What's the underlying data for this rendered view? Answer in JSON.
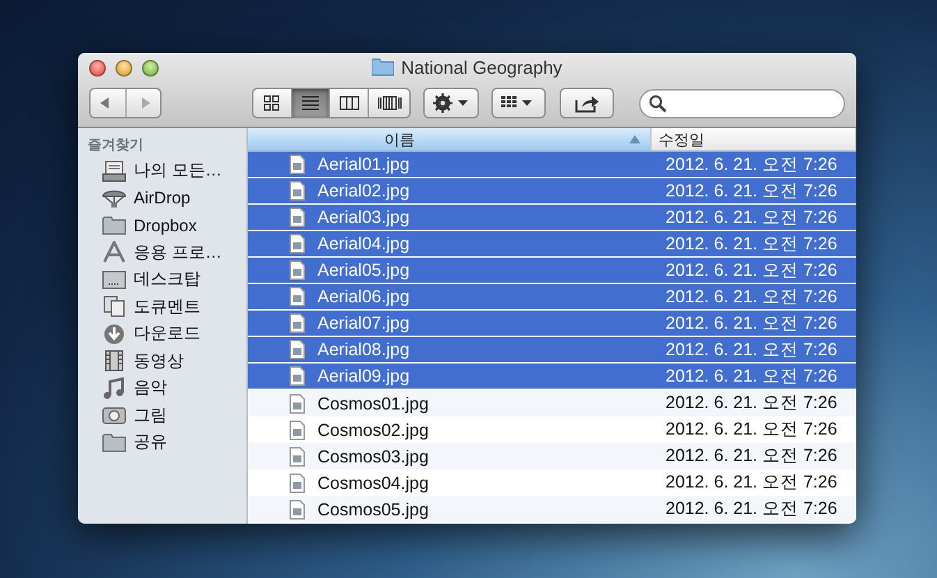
{
  "window": {
    "title": "National Geography"
  },
  "toolbar": {
    "view_modes": [
      {
        "kind": "icon",
        "selected": false
      },
      {
        "kind": "list",
        "selected": true
      },
      {
        "kind": "columns",
        "selected": false
      },
      {
        "kind": "coverflow",
        "selected": false
      }
    ]
  },
  "sidebar": {
    "heading": "즐겨찾기",
    "items": [
      {
        "label": "나의 모든…",
        "kind": "allfiles"
      },
      {
        "label": "AirDrop",
        "kind": "airdrop"
      },
      {
        "label": "Dropbox",
        "kind": "folder"
      },
      {
        "label": "응용 프로…",
        "kind": "apps"
      },
      {
        "label": "데스크탑",
        "kind": "desktop"
      },
      {
        "label": "도큐멘트",
        "kind": "documents"
      },
      {
        "label": "다운로드",
        "kind": "downloads"
      },
      {
        "label": "동영상",
        "kind": "movies"
      },
      {
        "label": "음악",
        "kind": "music"
      },
      {
        "label": "그림",
        "kind": "pictures"
      },
      {
        "label": "공유",
        "kind": "folder"
      }
    ]
  },
  "table": {
    "columns": [
      {
        "label": "이름",
        "sorted": true
      },
      {
        "label": "수정일",
        "sorted": false
      }
    ],
    "rows": [
      {
        "name": "Aerial01.jpg",
        "modified": "2012. 6. 21. 오전 7:26",
        "selected": true
      },
      {
        "name": "Aerial02.jpg",
        "modified": "2012. 6. 21. 오전 7:26",
        "selected": true
      },
      {
        "name": "Aerial03.jpg",
        "modified": "2012. 6. 21. 오전 7:26",
        "selected": true
      },
      {
        "name": "Aerial04.jpg",
        "modified": "2012. 6. 21. 오전 7:26",
        "selected": true
      },
      {
        "name": "Aerial05.jpg",
        "modified": "2012. 6. 21. 오전 7:26",
        "selected": true
      },
      {
        "name": "Aerial06.jpg",
        "modified": "2012. 6. 21. 오전 7:26",
        "selected": true
      },
      {
        "name": "Aerial07.jpg",
        "modified": "2012. 6. 21. 오전 7:26",
        "selected": true
      },
      {
        "name": "Aerial08.jpg",
        "modified": "2012. 6. 21. 오전 7:26",
        "selected": true
      },
      {
        "name": "Aerial09.jpg",
        "modified": "2012. 6. 21. 오전 7:26",
        "selected": true
      },
      {
        "name": "Cosmos01.jpg",
        "modified": "2012. 6. 21. 오전 7:26",
        "selected": false
      },
      {
        "name": "Cosmos02.jpg",
        "modified": "2012. 6. 21. 오전 7:26",
        "selected": false
      },
      {
        "name": "Cosmos03.jpg",
        "modified": "2012. 6. 21. 오전 7:26",
        "selected": false
      },
      {
        "name": "Cosmos04.jpg",
        "modified": "2012. 6. 21. 오전 7:26",
        "selected": false
      },
      {
        "name": "Cosmos05.jpg",
        "modified": "2012. 6. 21. 오전 7:26",
        "selected": false
      }
    ]
  }
}
